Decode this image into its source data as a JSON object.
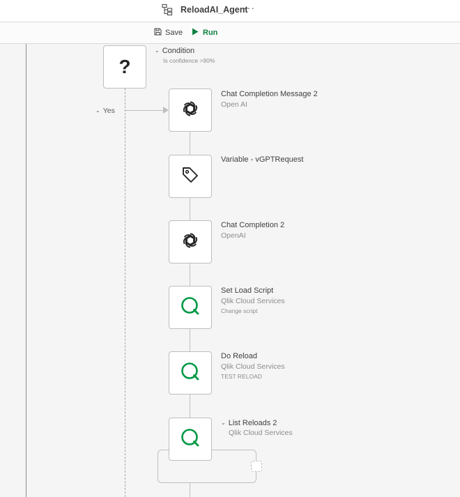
{
  "header": {
    "app_title": "ReloadAI_Agent",
    "more_label": "···",
    "app_icon": "automation-flow-icon"
  },
  "toolbar": {
    "save_label": "Save",
    "run_label": "Run",
    "save_icon": "save-icon",
    "run_icon": "play-icon",
    "run_color": "#0f8040"
  },
  "flow": {
    "condition": {
      "symbol": "?",
      "title": "Condition",
      "subtitle": "Is confidence >90%"
    },
    "yes_branch_label": "Yes",
    "blocks": [
      {
        "icon": "openai-icon",
        "title": "Chat Completion Message 2",
        "subtitle": "Open AI",
        "note": ""
      },
      {
        "icon": "tag-icon",
        "title": "Variable - vGPTRequest",
        "subtitle": "",
        "note": ""
      },
      {
        "icon": "openai-icon",
        "title": "Chat Completion 2",
        "subtitle": "OpenAI",
        "note": ""
      },
      {
        "icon": "qlik-icon",
        "title": "Set Load Script",
        "subtitle": "Qlik Cloud Services",
        "note": "Change script"
      },
      {
        "icon": "qlik-icon",
        "title": "Do Reload",
        "subtitle": "Qlik Cloud Services",
        "note": "TEST RELOAD"
      },
      {
        "icon": "qlik-icon",
        "title": "List Reloads 2",
        "subtitle": "Qlik Cloud Services",
        "note": ""
      }
    ],
    "qlik_color": "#009845"
  }
}
